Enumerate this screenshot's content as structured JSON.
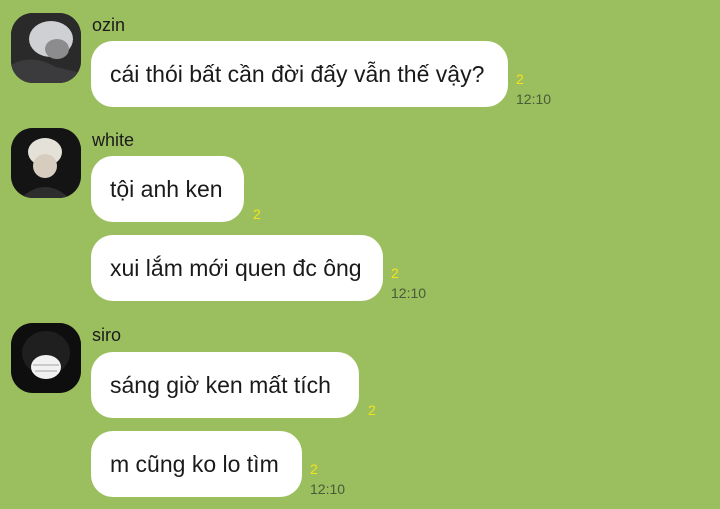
{
  "groups": [
    {
      "sender": "ozin",
      "avatar_icon": "user-avatar-icon",
      "messages": [
        {
          "text": "cái thói bất cần đời đấy vẫn thế vậy?",
          "read_count": "2",
          "time": "12:10"
        }
      ]
    },
    {
      "sender": "white",
      "avatar_icon": "user-avatar-icon",
      "messages": [
        {
          "text": "tội anh ken",
          "read_count": "2",
          "time": ""
        },
        {
          "text": "xui lắm mới quen đc ông",
          "read_count": "2",
          "time": "12:10"
        }
      ]
    },
    {
      "sender": "siro",
      "avatar_icon": "user-avatar-icon",
      "messages": [
        {
          "text": "sáng giờ ken mất tích",
          "read_count": "2",
          "time": ""
        },
        {
          "text": "m cũng ko lo tìm",
          "read_count": "2",
          "time": "12:10"
        }
      ]
    }
  ],
  "colors": {
    "background": "#9bbf5f",
    "bubble": "#ffffff",
    "read_count": "#f4e21a",
    "timestamp": "#4a5a3a"
  }
}
